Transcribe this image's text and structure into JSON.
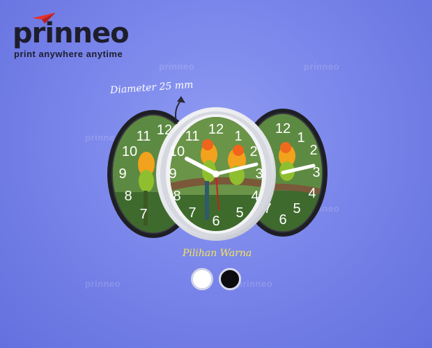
{
  "brand": {
    "name": "prinneo",
    "tagline": "print anywhere anytime",
    "accent_color": "#e5322d"
  },
  "watermark_text": "prinneo",
  "annotation": {
    "label": "Diameter 25 mm",
    "icon": "curved-arrow-icon"
  },
  "clock": {
    "numbers": [
      "12",
      "1",
      "2",
      "3",
      "4",
      "5",
      "6",
      "7",
      "8",
      "9",
      "10",
      "11"
    ],
    "variants": [
      "black-frame",
      "white-frame"
    ]
  },
  "options": {
    "title": "Pilihan Warna",
    "swatches": [
      {
        "name": "white",
        "color": "#ffffff"
      },
      {
        "name": "black",
        "color": "#0c0c10"
      }
    ]
  }
}
